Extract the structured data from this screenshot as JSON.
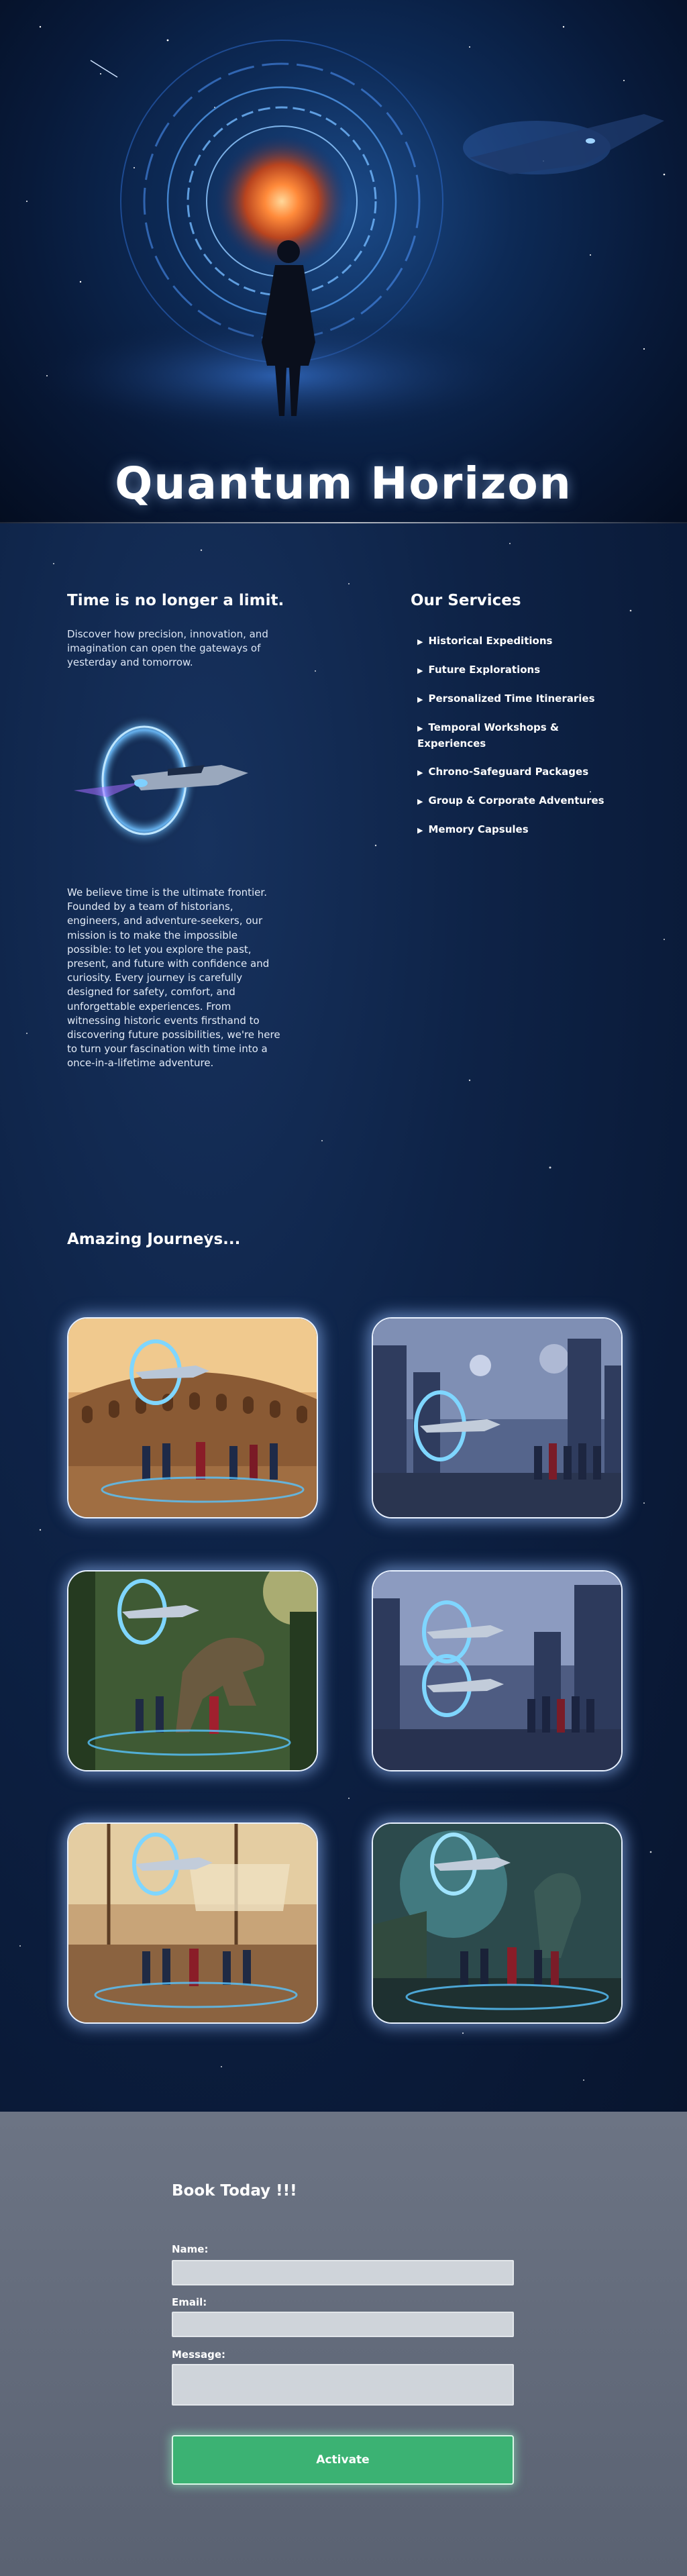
{
  "hero": {
    "title": "Quantum Horizon"
  },
  "intro": {
    "title": "Time is no longer a limit.",
    "text": "Discover how precision, innovation, and imagination can open the gateways of yesterday and tomorrow.",
    "about": "We believe time is the ultimate frontier. Founded by a team of historians, engineers, and adventure-seekers, our mission is to make the impossible possible: to let you explore the past, present, and future with confidence and curiosity. Every journey is carefully designed for safety, comfort, and unforgettable experiences. From witnessing historic events firsthand to discovering future possibilities, we're here to turn your fascination with time into a once-in-a-lifetime adventure."
  },
  "services": {
    "title": "Our Services",
    "items": [
      {
        "label": "Historical Expeditions"
      },
      {
        "label": "Future Explorations"
      },
      {
        "label": "Personalized Time Itineraries"
      },
      {
        "label": "Temporal Workshops & Experiences"
      },
      {
        "label": "Chrono-Safeguard Packages"
      },
      {
        "label": "Group & Corporate Adventures"
      },
      {
        "label": "Memory Capsules"
      }
    ]
  },
  "journeys": {
    "title": "Amazing Journeys...",
    "images": [
      {
        "scene": "ancient-colosseum"
      },
      {
        "scene": "futuristic-city"
      },
      {
        "scene": "dinosaur-jungle"
      },
      {
        "scene": "cyber-metropolis"
      },
      {
        "scene": "pirate-harbor"
      },
      {
        "scene": "ancient-temple-dragon"
      }
    ]
  },
  "booking": {
    "title": "Book Today !!!",
    "name_label": "Name:",
    "email_label": "Email:",
    "message_label": "Message:",
    "name_value": "",
    "email_value": "",
    "message_value": "",
    "submit_label": "Activate"
  },
  "colors": {
    "accent_green": "#3bb273",
    "portal_blue": "#4aa8ff",
    "portal_orange": "#ff7a2e",
    "booking_bg": "#656d7d"
  }
}
